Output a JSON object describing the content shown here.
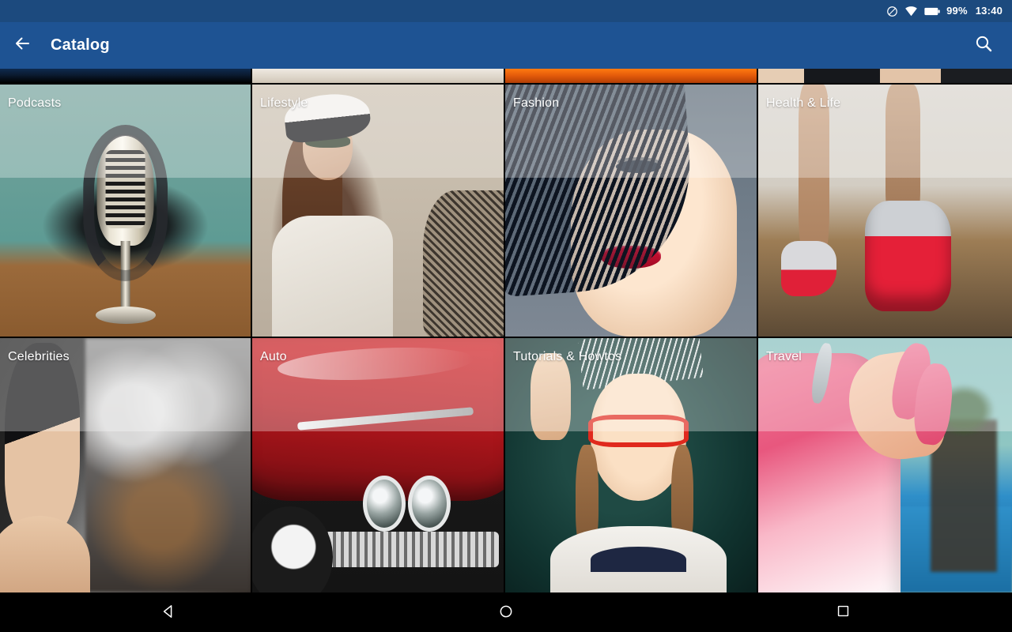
{
  "status_bar": {
    "background": "#1c4a7e",
    "icons": [
      {
        "name": "do-not-disturb-icon",
        "glyph": "circle-slash"
      },
      {
        "name": "wifi-icon",
        "glyph": "wifi"
      },
      {
        "name": "battery-icon",
        "glyph": "battery-full"
      }
    ],
    "battery_percent": "99%",
    "clock": "13:40"
  },
  "toolbar": {
    "background": "#1e5393",
    "back_icon": "arrow-back-icon",
    "title": "Catalog",
    "search_icon": "search-icon"
  },
  "catalog": {
    "peek_row": [
      {
        "label": "",
        "art": "art-peek-1"
      },
      {
        "label": "",
        "art": "art-peek-2"
      },
      {
        "label": "",
        "art": "art-peek-3"
      },
      {
        "label": "",
        "art": "art-peek-4"
      }
    ],
    "tiles": [
      {
        "label": "Podcasts",
        "art": "art-podcasts"
      },
      {
        "label": "Lifestyle",
        "art": "art-lifestyle"
      },
      {
        "label": "Fashion",
        "art": "art-fashion"
      },
      {
        "label": "Health & Life",
        "art": "art-health"
      },
      {
        "label": "Celebrities",
        "art": "art-celebrities"
      },
      {
        "label": "Auto",
        "art": "art-auto"
      },
      {
        "label": "Tutorials & Howtos",
        "art": "art-tutorials"
      },
      {
        "label": "Travel",
        "art": "art-travel"
      }
    ]
  },
  "nav_bar": {
    "background": "#000000",
    "buttons": [
      {
        "name": "nav-back-button",
        "icon": "triangle-back-icon"
      },
      {
        "name": "nav-home-button",
        "icon": "circle-home-icon"
      },
      {
        "name": "nav-recents-button",
        "icon": "square-recents-icon"
      }
    ]
  }
}
